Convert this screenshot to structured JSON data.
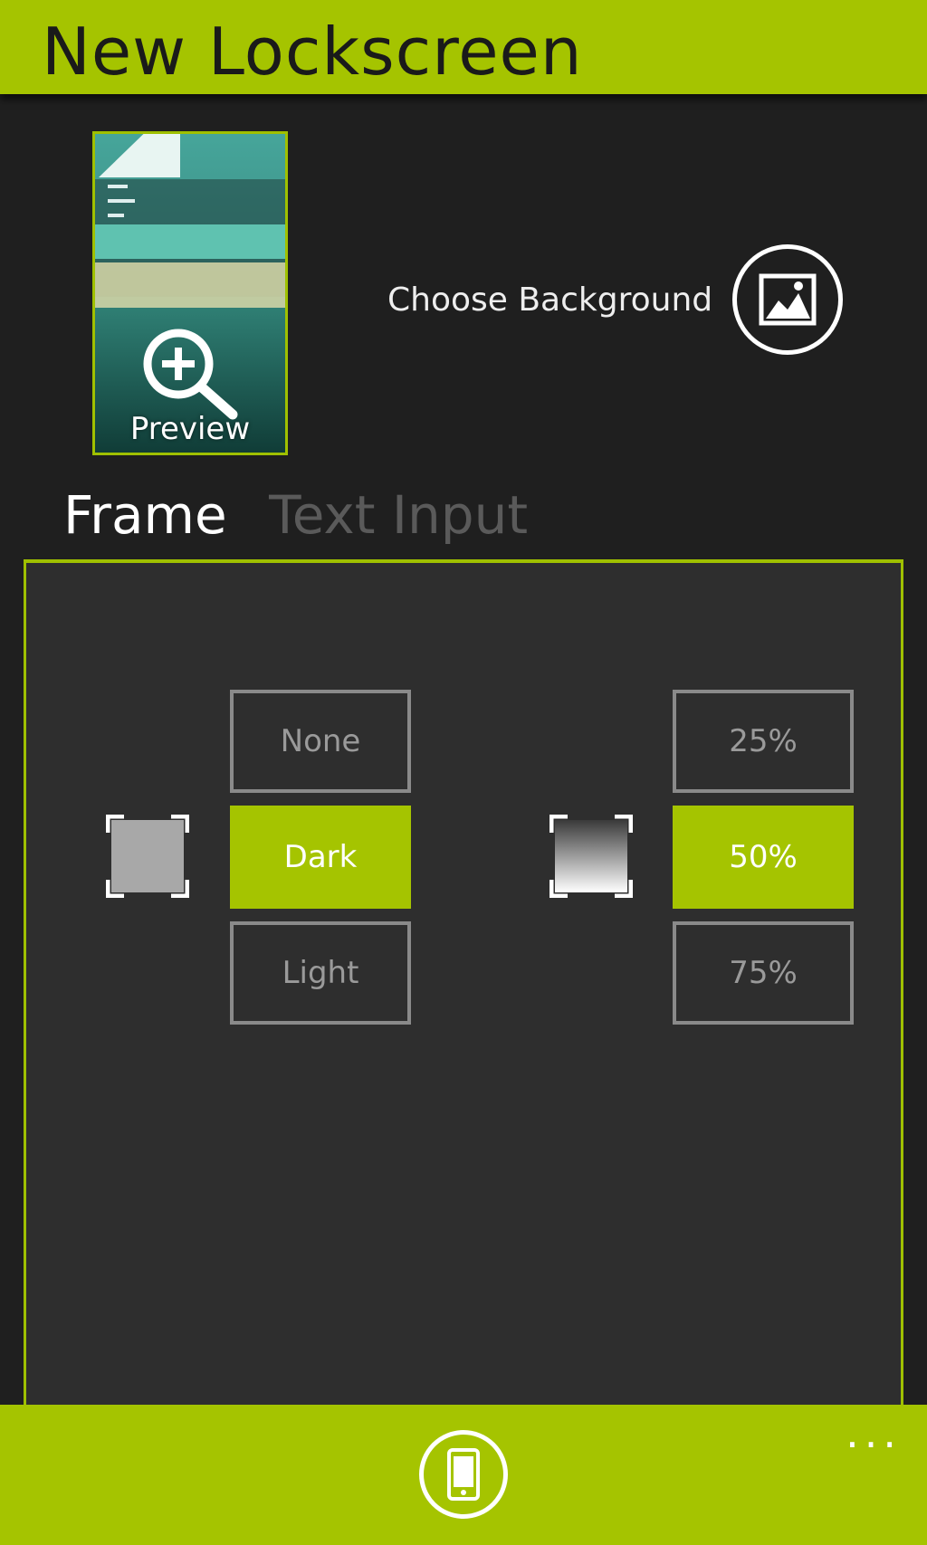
{
  "header": {
    "title": "New Lockscreen"
  },
  "preview": {
    "label": "Preview",
    "icon": "zoom-in-icon"
  },
  "background": {
    "label": "Choose Background",
    "icon": "picture-icon"
  },
  "tabs": [
    {
      "label": "Frame",
      "active": true
    },
    {
      "label": "Text Input",
      "active": false
    }
  ],
  "frame_style": {
    "options": [
      "None",
      "Dark",
      "Light"
    ],
    "selected": "Dark"
  },
  "opacity": {
    "options": [
      "25%",
      "50%",
      "75%"
    ],
    "selected": "50%"
  },
  "appbar": {
    "more": "...",
    "icon": "phone-preview-icon"
  },
  "colors": {
    "accent": "#a5c400",
    "background": "#1f1f1f",
    "panel": "#2e2e2e",
    "border": "#8a8a8a"
  }
}
